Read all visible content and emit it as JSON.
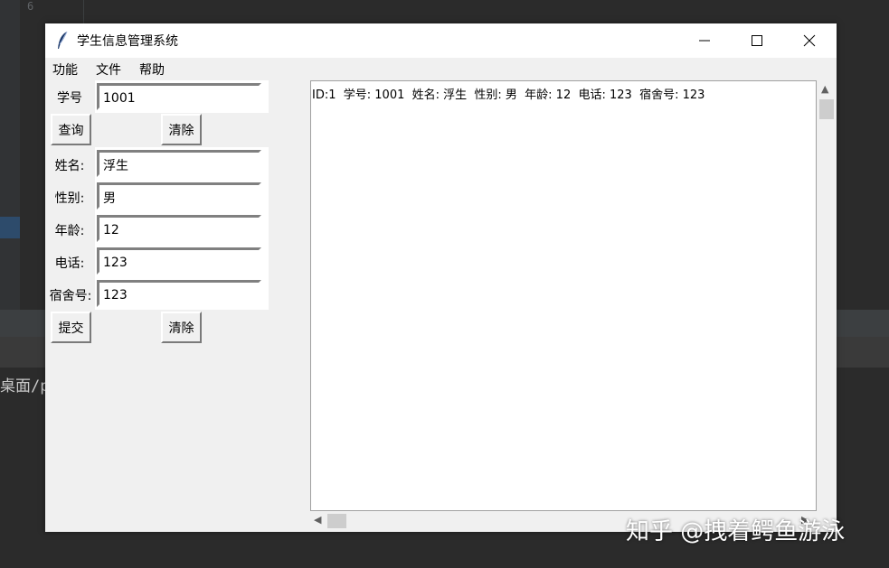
{
  "ide": {
    "line_number": "6",
    "terminal_text": "桌面/p"
  },
  "window": {
    "title": "学生信息管理系统",
    "menu": [
      "功能",
      "文件",
      "帮助"
    ]
  },
  "form": {
    "student_id_label": "学号",
    "student_id_value": "1001",
    "query_button": "查询",
    "clear_button_top": "清除",
    "name_label": "姓名:",
    "name_value": "浮生",
    "gender_label": "性别:",
    "gender_value": "男",
    "age_label": "年龄:",
    "age_value": "12",
    "phone_label": "电话:",
    "phone_value": "123",
    "dorm_label": "宿舍号:",
    "dorm_value": "123",
    "submit_button": "提交",
    "clear_button_bottom": "清除"
  },
  "output": {
    "line1": "ID:1  学号: 1001  姓名: 浮生  性别: 男  年龄: 12  电话: 123  宿舍号: 123"
  },
  "watermark": "知乎 @拽着鳄鱼游泳"
}
